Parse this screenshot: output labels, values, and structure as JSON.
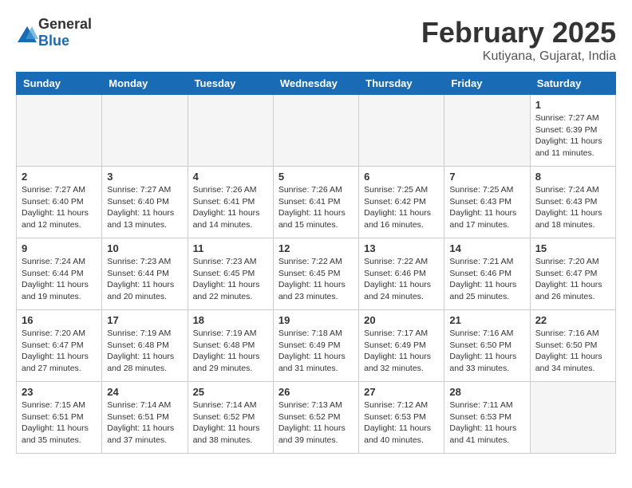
{
  "header": {
    "logo_general": "General",
    "logo_blue": "Blue",
    "month": "February 2025",
    "location": "Kutiyana, Gujarat, India"
  },
  "days_of_week": [
    "Sunday",
    "Monday",
    "Tuesday",
    "Wednesday",
    "Thursday",
    "Friday",
    "Saturday"
  ],
  "weeks": [
    [
      {
        "day": "",
        "info": ""
      },
      {
        "day": "",
        "info": ""
      },
      {
        "day": "",
        "info": ""
      },
      {
        "day": "",
        "info": ""
      },
      {
        "day": "",
        "info": ""
      },
      {
        "day": "",
        "info": ""
      },
      {
        "day": "1",
        "info": "Sunrise: 7:27 AM\nSunset: 6:39 PM\nDaylight: 11 hours\nand 11 minutes."
      }
    ],
    [
      {
        "day": "2",
        "info": "Sunrise: 7:27 AM\nSunset: 6:40 PM\nDaylight: 11 hours\nand 12 minutes."
      },
      {
        "day": "3",
        "info": "Sunrise: 7:27 AM\nSunset: 6:40 PM\nDaylight: 11 hours\nand 13 minutes."
      },
      {
        "day": "4",
        "info": "Sunrise: 7:26 AM\nSunset: 6:41 PM\nDaylight: 11 hours\nand 14 minutes."
      },
      {
        "day": "5",
        "info": "Sunrise: 7:26 AM\nSunset: 6:41 PM\nDaylight: 11 hours\nand 15 minutes."
      },
      {
        "day": "6",
        "info": "Sunrise: 7:25 AM\nSunset: 6:42 PM\nDaylight: 11 hours\nand 16 minutes."
      },
      {
        "day": "7",
        "info": "Sunrise: 7:25 AM\nSunset: 6:43 PM\nDaylight: 11 hours\nand 17 minutes."
      },
      {
        "day": "8",
        "info": "Sunrise: 7:24 AM\nSunset: 6:43 PM\nDaylight: 11 hours\nand 18 minutes."
      }
    ],
    [
      {
        "day": "9",
        "info": "Sunrise: 7:24 AM\nSunset: 6:44 PM\nDaylight: 11 hours\nand 19 minutes."
      },
      {
        "day": "10",
        "info": "Sunrise: 7:23 AM\nSunset: 6:44 PM\nDaylight: 11 hours\nand 20 minutes."
      },
      {
        "day": "11",
        "info": "Sunrise: 7:23 AM\nSunset: 6:45 PM\nDaylight: 11 hours\nand 22 minutes."
      },
      {
        "day": "12",
        "info": "Sunrise: 7:22 AM\nSunset: 6:45 PM\nDaylight: 11 hours\nand 23 minutes."
      },
      {
        "day": "13",
        "info": "Sunrise: 7:22 AM\nSunset: 6:46 PM\nDaylight: 11 hours\nand 24 minutes."
      },
      {
        "day": "14",
        "info": "Sunrise: 7:21 AM\nSunset: 6:46 PM\nDaylight: 11 hours\nand 25 minutes."
      },
      {
        "day": "15",
        "info": "Sunrise: 7:20 AM\nSunset: 6:47 PM\nDaylight: 11 hours\nand 26 minutes."
      }
    ],
    [
      {
        "day": "16",
        "info": "Sunrise: 7:20 AM\nSunset: 6:47 PM\nDaylight: 11 hours\nand 27 minutes."
      },
      {
        "day": "17",
        "info": "Sunrise: 7:19 AM\nSunset: 6:48 PM\nDaylight: 11 hours\nand 28 minutes."
      },
      {
        "day": "18",
        "info": "Sunrise: 7:19 AM\nSunset: 6:48 PM\nDaylight: 11 hours\nand 29 minutes."
      },
      {
        "day": "19",
        "info": "Sunrise: 7:18 AM\nSunset: 6:49 PM\nDaylight: 11 hours\nand 31 minutes."
      },
      {
        "day": "20",
        "info": "Sunrise: 7:17 AM\nSunset: 6:49 PM\nDaylight: 11 hours\nand 32 minutes."
      },
      {
        "day": "21",
        "info": "Sunrise: 7:16 AM\nSunset: 6:50 PM\nDaylight: 11 hours\nand 33 minutes."
      },
      {
        "day": "22",
        "info": "Sunrise: 7:16 AM\nSunset: 6:50 PM\nDaylight: 11 hours\nand 34 minutes."
      }
    ],
    [
      {
        "day": "23",
        "info": "Sunrise: 7:15 AM\nSunset: 6:51 PM\nDaylight: 11 hours\nand 35 minutes."
      },
      {
        "day": "24",
        "info": "Sunrise: 7:14 AM\nSunset: 6:51 PM\nDaylight: 11 hours\nand 37 minutes."
      },
      {
        "day": "25",
        "info": "Sunrise: 7:14 AM\nSunset: 6:52 PM\nDaylight: 11 hours\nand 38 minutes."
      },
      {
        "day": "26",
        "info": "Sunrise: 7:13 AM\nSunset: 6:52 PM\nDaylight: 11 hours\nand 39 minutes."
      },
      {
        "day": "27",
        "info": "Sunrise: 7:12 AM\nSunset: 6:53 PM\nDaylight: 11 hours\nand 40 minutes."
      },
      {
        "day": "28",
        "info": "Sunrise: 7:11 AM\nSunset: 6:53 PM\nDaylight: 11 hours\nand 41 minutes."
      },
      {
        "day": "",
        "info": ""
      }
    ]
  ]
}
